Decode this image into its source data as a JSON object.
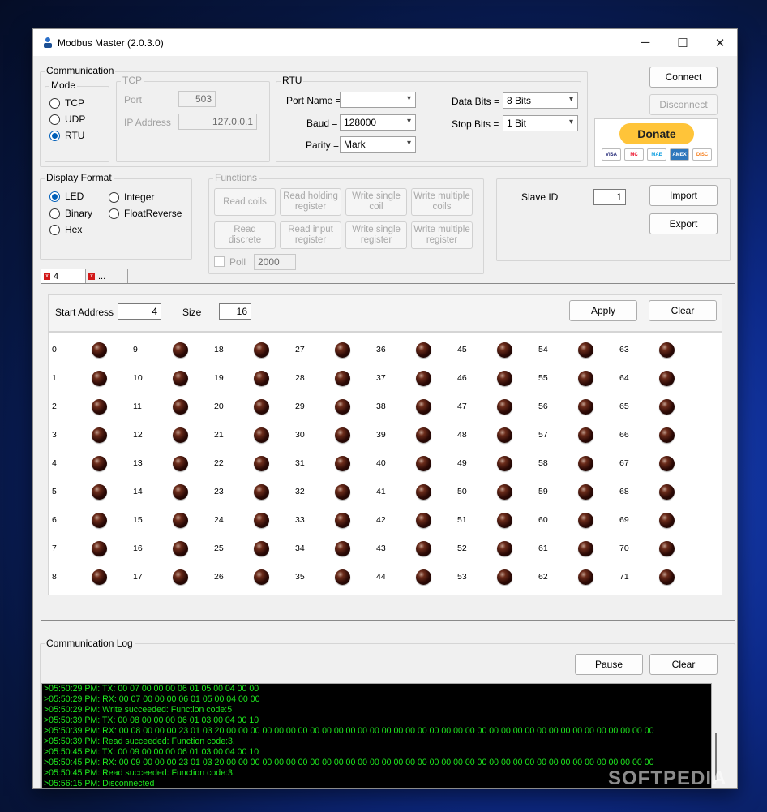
{
  "window": {
    "title": "Modbus Master (2.0.3.0)",
    "minimize": "─",
    "maximize": "☐",
    "close": "✕"
  },
  "communication": {
    "group_label": "Communication",
    "mode_label": "Mode",
    "modes": [
      {
        "label": "TCP",
        "selected": false
      },
      {
        "label": "UDP",
        "selected": false
      },
      {
        "label": "RTU",
        "selected": true
      }
    ],
    "tcp": {
      "label": "TCP",
      "port_label": "Port",
      "port_value": "503",
      "ip_label": "IP Address",
      "ip_value": "127.0.0.1"
    },
    "rtu": {
      "label": "RTU",
      "port_name_label": "Port Name =",
      "port_name_value": "",
      "baud_label": "Baud =",
      "baud_value": "128000",
      "parity_label": "Parity =",
      "parity_value": "Mark",
      "data_bits_label": "Data Bits =",
      "data_bits_value": "8 Bits",
      "stop_bits_label": "Stop Bits =",
      "stop_bits_value": "1 Bit"
    }
  },
  "connection": {
    "connect": "Connect",
    "disconnect": "Disconnect"
  },
  "donate": {
    "label": "Donate",
    "cards": [
      "VISA",
      "MC",
      "MAE",
      "AMEX",
      "DISC"
    ]
  },
  "display_format": {
    "label": "Display Format",
    "options": [
      {
        "label": "LED",
        "selected": true
      },
      {
        "label": "Binary",
        "selected": false
      },
      {
        "label": "Hex",
        "selected": false
      },
      {
        "label": "Integer",
        "selected": false
      },
      {
        "label": "FloatReverse",
        "selected": false
      }
    ]
  },
  "functions": {
    "label": "Functions",
    "buttons": [
      {
        "line1": "Read coils",
        "line2": ""
      },
      {
        "line1": "Read holding",
        "line2": "register"
      },
      {
        "line1": "Write single",
        "line2": "coil"
      },
      {
        "line1": "Write multiple",
        "line2": "coils"
      },
      {
        "line1": "Read",
        "line2": "discrete"
      },
      {
        "line1": "Read input",
        "line2": "register"
      },
      {
        "line1": "Write single",
        "line2": "register"
      },
      {
        "line1": "Write multiple",
        "line2": "register"
      }
    ],
    "poll_label": "Poll",
    "poll_value": "2000"
  },
  "slave": {
    "label": "Slave ID",
    "value": "1",
    "import": "Import",
    "export": "Export"
  },
  "tabs": [
    {
      "label": "4"
    },
    {
      "label": "..."
    }
  ],
  "register_panel": {
    "start_address_label": "Start Address",
    "start_address_value": "4",
    "size_label": "Size",
    "size_value": "16",
    "apply": "Apply",
    "clear": "Clear"
  },
  "leds": [
    [
      "0",
      "9",
      "18",
      "27",
      "36",
      "45",
      "54",
      "63"
    ],
    [
      "1",
      "10",
      "19",
      "28",
      "37",
      "46",
      "55",
      "64"
    ],
    [
      "2",
      "11",
      "20",
      "29",
      "38",
      "47",
      "56",
      "65"
    ],
    [
      "3",
      "12",
      "21",
      "30",
      "39",
      "48",
      "57",
      "66"
    ],
    [
      "4",
      "13",
      "22",
      "31",
      "40",
      "49",
      "58",
      "67"
    ],
    [
      "5",
      "14",
      "23",
      "32",
      "41",
      "50",
      "59",
      "68"
    ],
    [
      "6",
      "15",
      "24",
      "33",
      "42",
      "51",
      "60",
      "69"
    ],
    [
      "7",
      "16",
      "25",
      "34",
      "43",
      "52",
      "61",
      "70"
    ],
    [
      "8",
      "17",
      "26",
      "35",
      "44",
      "53",
      "62",
      "71"
    ]
  ],
  "log": {
    "label": "Communication Log",
    "pause": "Pause",
    "clear": "Clear",
    "lines": [
      ">05:50:29 PM: TX: 00 07 00 00 00 06 01 05 00 04 00 00",
      ">05:50:29 PM: RX: 00 07 00 00 00 06 01 05 00 04 00 00",
      ">05:50:29 PM: Write succeeded: Function code:5",
      ">05:50:39 PM: TX: 00 08 00 00 00 06 01 03 00 04 00 10",
      ">05:50:39 PM: RX: 00 08 00 00 00 23 01 03 20 00 00 00 00 00 00 00 00 00 00 00 00 00 00 00 00 00 00 00 00 00 00 00 00 00 00 00 00 00 00 00 00 00 00 00 00",
      ">05:50:39 PM: Read succeeded: Function code:3.",
      ">05:50:45 PM: TX: 00 09 00 00 00 06 01 03 00 04 00 10",
      ">05:50:45 PM: RX: 00 09 00 00 00 23 01 03 20 00 00 00 00 00 00 00 00 00 00 00 00 00 00 00 00 00 00 00 00 00 00 00 00 00 00 00 00 00 00 00 00 00 00 00 00",
      ">05:50:45 PM: Read succeeded: Function code:3.",
      ">05:56:15 PM: Disconnected"
    ]
  },
  "watermark": "SOFTPEDIA"
}
